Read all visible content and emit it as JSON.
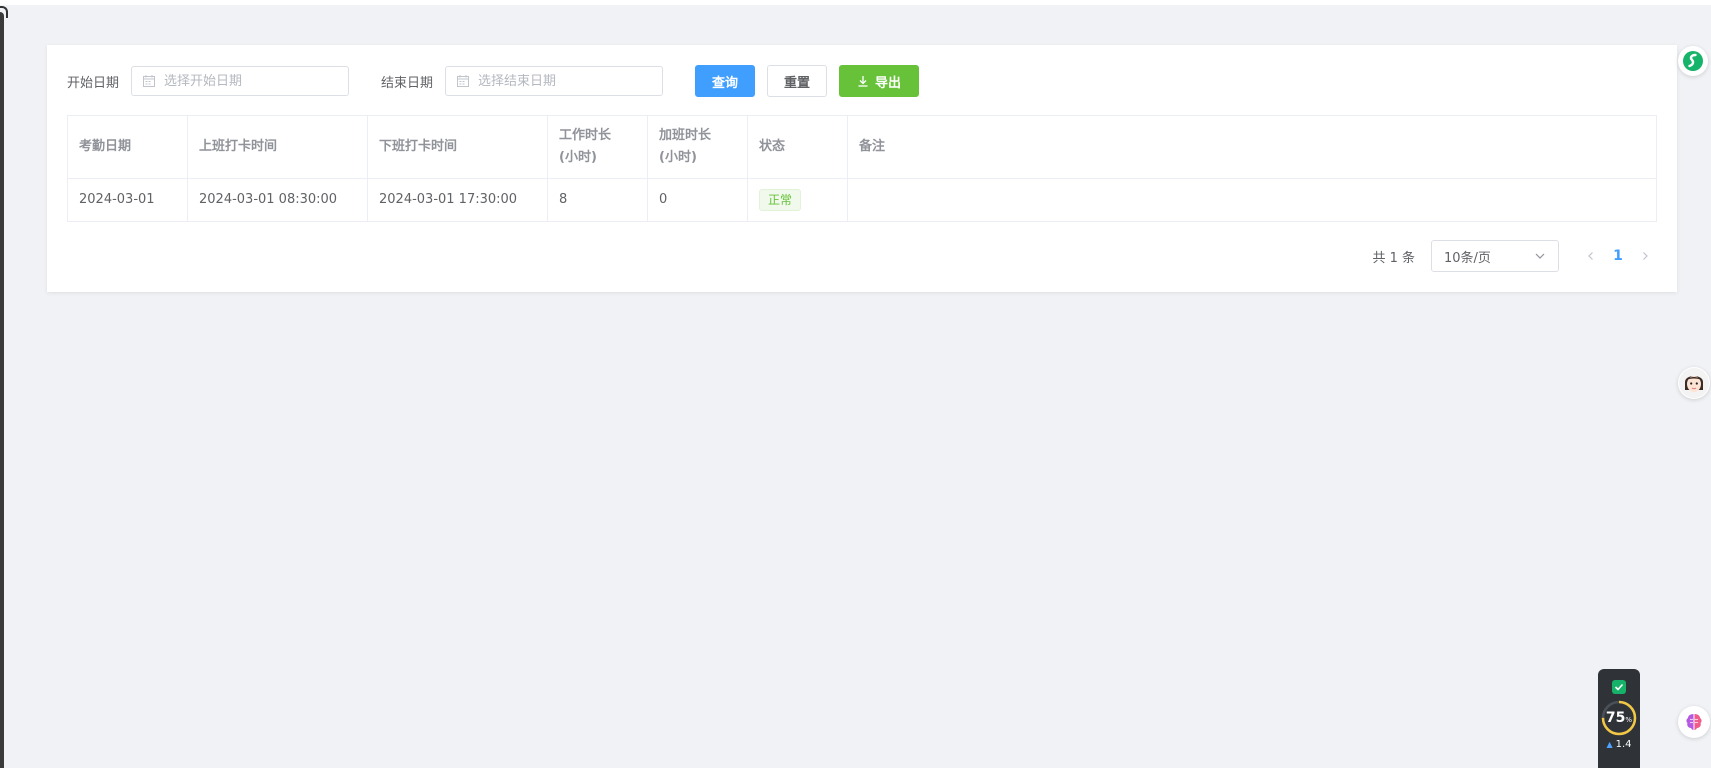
{
  "filters": {
    "start_label": "开始日期",
    "start_placeholder": "选择开始日期",
    "end_label": "结束日期",
    "end_placeholder": "选择结束日期"
  },
  "buttons": {
    "query": "查询",
    "reset": "重置",
    "export": "导出"
  },
  "table": {
    "columns": [
      {
        "line1": "考勤日期",
        "line2": ""
      },
      {
        "line1": "上班打卡时间",
        "line2": ""
      },
      {
        "line1": "下班打卡时间",
        "line2": ""
      },
      {
        "line1": "工作时长",
        "line2": "(小时)"
      },
      {
        "line1": "加班时长",
        "line2": "(小时)"
      },
      {
        "line1": "状态",
        "line2": ""
      },
      {
        "line1": "备注",
        "line2": ""
      }
    ],
    "rows": [
      {
        "date": "2024-03-01",
        "clock_in": "2024-03-01 08:30:00",
        "clock_out": "2024-03-01 17:30:00",
        "work_hours": "8",
        "overtime_hours": "0",
        "status": "正常",
        "remark": ""
      }
    ]
  },
  "pagination": {
    "total": "共 1 条",
    "page_size": "10条/页",
    "current_page": "1"
  },
  "monitor_widget": {
    "percent": "75",
    "percent_unit": "%",
    "speed": "1.4"
  },
  "colors": {
    "primary": "#409eff",
    "success": "#67c23a",
    "background": "#f0f2f5"
  }
}
